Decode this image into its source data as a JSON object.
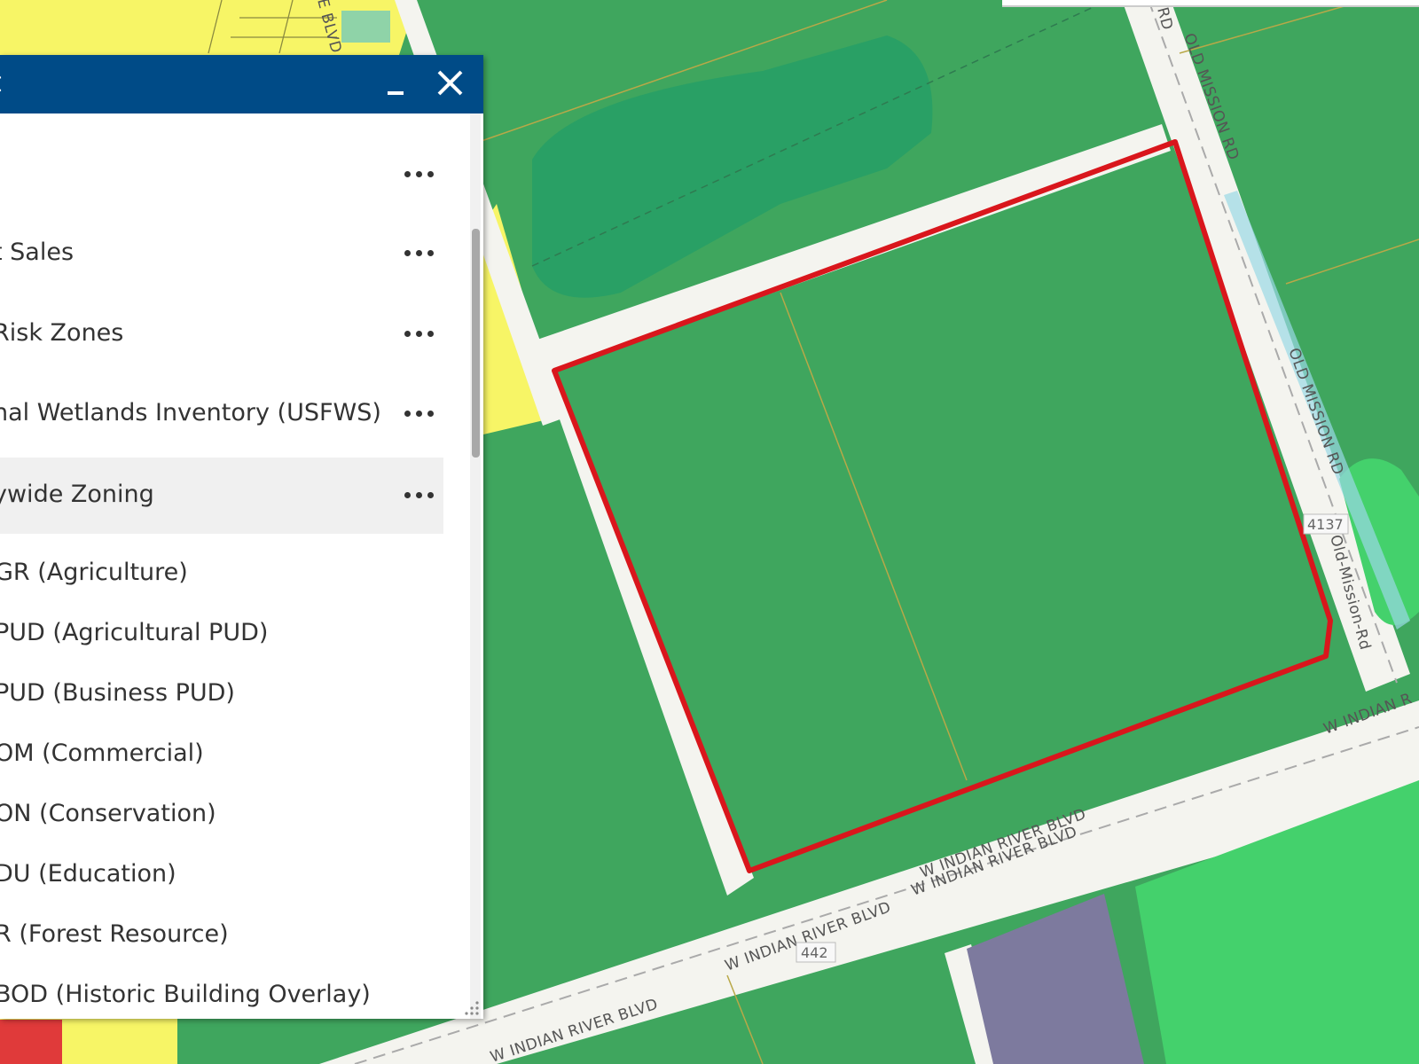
{
  "panel": {
    "title": "t",
    "layers": [
      {
        "label": "",
        "highlighted": false
      },
      {
        "label": "t Sales",
        "highlighted": false
      },
      {
        "label": "Risk Zones",
        "highlighted": false
      },
      {
        "label": "nal Wetlands Inventory (USFWS)",
        "highlighted": false
      },
      {
        "label": "ywide Zoning",
        "highlighted": true
      }
    ],
    "legend": [
      "GR (Agriculture)",
      "PUD (Agricultural PUD)",
      "PUD (Business PUD)",
      "OM (Commercial)",
      "ON (Conservation)",
      "DU (Education)",
      "R (Forest Resource)",
      "BOD (Historic Building Overlay)"
    ]
  },
  "map": {
    "roads": {
      "old_mission_1": "OLD MISSION RD",
      "old_mission_2": "OLD MISSION RD",
      "old_mission_3": "Old-Mission-Rd",
      "old_mission_top": "RD",
      "w_indian_river_1": "W INDIAN RIVER BLVD",
      "w_indian_river_2": "W INDIAN RIVER BLVD",
      "w_indian_river_3": "W INDIAN RIVER BLVD",
      "w_indian_river_4": "W INDIAN RIVER BLVD",
      "w_indian_river_5": "W INDIAN R",
      "left_road": "E BLVD"
    },
    "shields": {
      "route_442": "442",
      "route_4137": "4137"
    },
    "colors": {
      "agriculture": "#3fa65e",
      "parcel_outline": "#d9161c",
      "yellow_zone": "#ffff66",
      "purple_zone": "#7d7a9e",
      "light_green_zone": "#44d16c",
      "road": "#f4f4ef"
    }
  }
}
